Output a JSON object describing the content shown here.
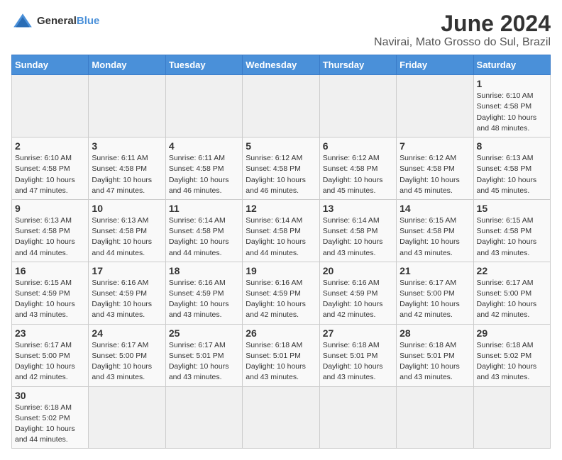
{
  "header": {
    "logo_general": "General",
    "logo_blue": "Blue",
    "month_title": "June 2024",
    "location": "Navirai, Mato Grosso do Sul, Brazil"
  },
  "weekdays": [
    "Sunday",
    "Monday",
    "Tuesday",
    "Wednesday",
    "Thursday",
    "Friday",
    "Saturday"
  ],
  "weeks": [
    [
      {
        "day": "",
        "info": ""
      },
      {
        "day": "",
        "info": ""
      },
      {
        "day": "",
        "info": ""
      },
      {
        "day": "",
        "info": ""
      },
      {
        "day": "",
        "info": ""
      },
      {
        "day": "",
        "info": ""
      },
      {
        "day": "1",
        "info": "Sunrise: 6:10 AM\nSunset: 4:58 PM\nDaylight: 10 hours\nand 48 minutes."
      }
    ],
    [
      {
        "day": "2",
        "info": "Sunrise: 6:10 AM\nSunset: 4:58 PM\nDaylight: 10 hours\nand 47 minutes."
      },
      {
        "day": "3",
        "info": "Sunrise: 6:11 AM\nSunset: 4:58 PM\nDaylight: 10 hours\nand 47 minutes."
      },
      {
        "day": "4",
        "info": "Sunrise: 6:11 AM\nSunset: 4:58 PM\nDaylight: 10 hours\nand 46 minutes."
      },
      {
        "day": "5",
        "info": "Sunrise: 6:12 AM\nSunset: 4:58 PM\nDaylight: 10 hours\nand 46 minutes."
      },
      {
        "day": "6",
        "info": "Sunrise: 6:12 AM\nSunset: 4:58 PM\nDaylight: 10 hours\nand 45 minutes."
      },
      {
        "day": "7",
        "info": "Sunrise: 6:12 AM\nSunset: 4:58 PM\nDaylight: 10 hours\nand 45 minutes."
      },
      {
        "day": "8",
        "info": "Sunrise: 6:13 AM\nSunset: 4:58 PM\nDaylight: 10 hours\nand 45 minutes."
      }
    ],
    [
      {
        "day": "9",
        "info": "Sunrise: 6:13 AM\nSunset: 4:58 PM\nDaylight: 10 hours\nand 44 minutes."
      },
      {
        "day": "10",
        "info": "Sunrise: 6:13 AM\nSunset: 4:58 PM\nDaylight: 10 hours\nand 44 minutes."
      },
      {
        "day": "11",
        "info": "Sunrise: 6:14 AM\nSunset: 4:58 PM\nDaylight: 10 hours\nand 44 minutes."
      },
      {
        "day": "12",
        "info": "Sunrise: 6:14 AM\nSunset: 4:58 PM\nDaylight: 10 hours\nand 44 minutes."
      },
      {
        "day": "13",
        "info": "Sunrise: 6:14 AM\nSunset: 4:58 PM\nDaylight: 10 hours\nand 43 minutes."
      },
      {
        "day": "14",
        "info": "Sunrise: 6:15 AM\nSunset: 4:58 PM\nDaylight: 10 hours\nand 43 minutes."
      },
      {
        "day": "15",
        "info": "Sunrise: 6:15 AM\nSunset: 4:58 PM\nDaylight: 10 hours\nand 43 minutes."
      }
    ],
    [
      {
        "day": "16",
        "info": "Sunrise: 6:15 AM\nSunset: 4:59 PM\nDaylight: 10 hours\nand 43 minutes."
      },
      {
        "day": "17",
        "info": "Sunrise: 6:16 AM\nSunset: 4:59 PM\nDaylight: 10 hours\nand 43 minutes."
      },
      {
        "day": "18",
        "info": "Sunrise: 6:16 AM\nSunset: 4:59 PM\nDaylight: 10 hours\nand 43 minutes."
      },
      {
        "day": "19",
        "info": "Sunrise: 6:16 AM\nSunset: 4:59 PM\nDaylight: 10 hours\nand 42 minutes."
      },
      {
        "day": "20",
        "info": "Sunrise: 6:16 AM\nSunset: 4:59 PM\nDaylight: 10 hours\nand 42 minutes."
      },
      {
        "day": "21",
        "info": "Sunrise: 6:17 AM\nSunset: 5:00 PM\nDaylight: 10 hours\nand 42 minutes."
      },
      {
        "day": "22",
        "info": "Sunrise: 6:17 AM\nSunset: 5:00 PM\nDaylight: 10 hours\nand 42 minutes."
      }
    ],
    [
      {
        "day": "23",
        "info": "Sunrise: 6:17 AM\nSunset: 5:00 PM\nDaylight: 10 hours\nand 42 minutes."
      },
      {
        "day": "24",
        "info": "Sunrise: 6:17 AM\nSunset: 5:00 PM\nDaylight: 10 hours\nand 43 minutes."
      },
      {
        "day": "25",
        "info": "Sunrise: 6:17 AM\nSunset: 5:01 PM\nDaylight: 10 hours\nand 43 minutes."
      },
      {
        "day": "26",
        "info": "Sunrise: 6:18 AM\nSunset: 5:01 PM\nDaylight: 10 hours\nand 43 minutes."
      },
      {
        "day": "27",
        "info": "Sunrise: 6:18 AM\nSunset: 5:01 PM\nDaylight: 10 hours\nand 43 minutes."
      },
      {
        "day": "28",
        "info": "Sunrise: 6:18 AM\nSunset: 5:01 PM\nDaylight: 10 hours\nand 43 minutes."
      },
      {
        "day": "29",
        "info": "Sunrise: 6:18 AM\nSunset: 5:02 PM\nDaylight: 10 hours\nand 43 minutes."
      }
    ],
    [
      {
        "day": "30",
        "info": "Sunrise: 6:18 AM\nSunset: 5:02 PM\nDaylight: 10 hours\nand 44 minutes."
      },
      {
        "day": "",
        "info": ""
      },
      {
        "day": "",
        "info": ""
      },
      {
        "day": "",
        "info": ""
      },
      {
        "day": "",
        "info": ""
      },
      {
        "day": "",
        "info": ""
      },
      {
        "day": "",
        "info": ""
      }
    ]
  ]
}
